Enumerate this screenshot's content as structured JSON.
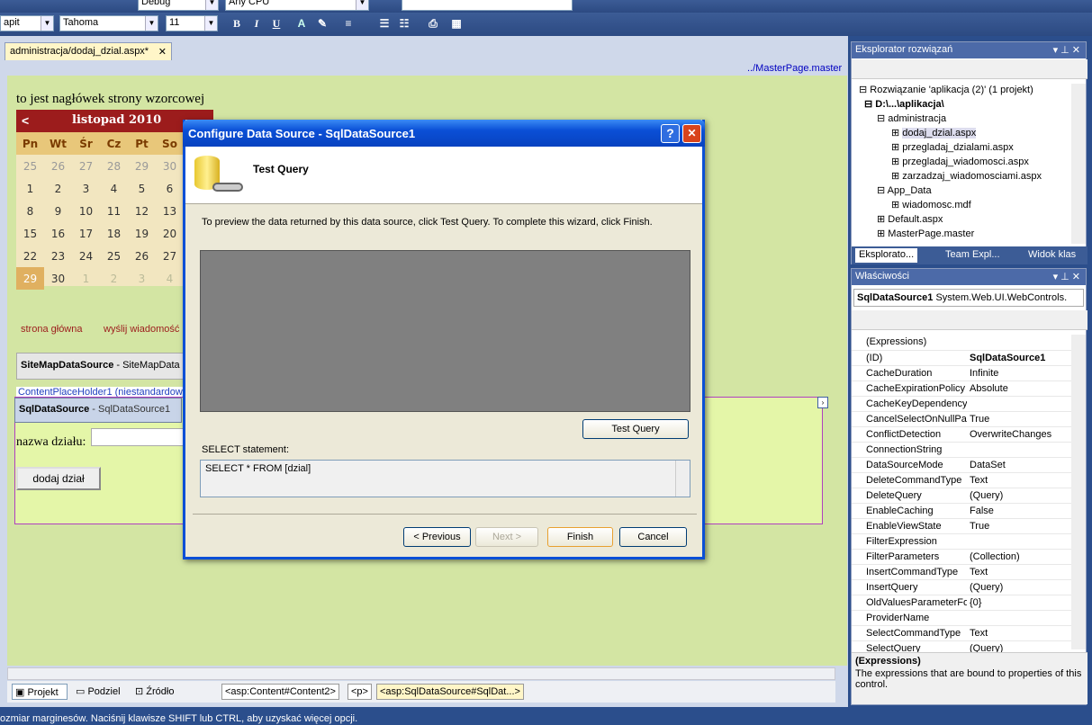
{
  "toolbar": {
    "config_combo": "Debug",
    "platform_combo": "Any CPU",
    "style_combo": "apit",
    "font_combo": "Tahoma",
    "size_combo": "11",
    "bold": "B",
    "italic": "I",
    "underline": "U",
    "font_color": "A"
  },
  "tab": {
    "label": "administracja/dodaj_dzial.aspx*",
    "close": "✕"
  },
  "master_link": "../MasterPage.master",
  "design": {
    "heading": "to jest nagłówek strony wzorcowej",
    "calendar": {
      "prev": "<",
      "title": "listopad 2010",
      "days": [
        "Pn",
        "Wt",
        "Śr",
        "Cz",
        "Pt",
        "So"
      ],
      "rows": [
        [
          "25",
          "26",
          "27",
          "28",
          "29",
          "30"
        ],
        [
          "1",
          "2",
          "3",
          "4",
          "5",
          "6"
        ],
        [
          "8",
          "9",
          "10",
          "11",
          "12",
          "13"
        ],
        [
          "15",
          "16",
          "17",
          "18",
          "19",
          "20"
        ],
        [
          "22",
          "23",
          "24",
          "25",
          "26",
          "27"
        ],
        [
          "29",
          "30",
          "1",
          "2",
          "3",
          "4"
        ]
      ]
    },
    "nav_home": "strona główna",
    "nav_send": "wyślij wiadomość",
    "sitemap_bold": "SiteMapDataSource",
    "sitemap_rest": " - SiteMapData",
    "placeholder": "ContentPlaceHolder1 (niestandardowy)",
    "sql_bold": "SqlDataSource",
    "sql_rest": " - SqlDataSource1",
    "field_label": "nazwa działu:",
    "add_button": "dodaj dział"
  },
  "bottom": {
    "design_tab": "Projekt",
    "split_tab": "Podziel",
    "source_tab": "Źródło",
    "crumbs": [
      "<asp:Content#Content2>",
      "<p>",
      "<asp:SqlDataSource#SqlDat...>"
    ]
  },
  "status": "ozmiar marginesów. Naciśnij klawisze SHIFT lub CTRL, aby uzyskać więcej opcji.",
  "solution": {
    "title": "Eksplorator rozwiązań",
    "items": [
      "Rozwiązanie 'aplikacja (2)' (1 projekt)",
      "D:\\...\\aplikacja\\",
      "administracja",
      "dodaj_dzial.aspx",
      "przegladaj_dzialami.aspx",
      "przegladaj_wiadomosci.aspx",
      "zarzadzaj_wiadomosciami.aspx",
      "App_Data",
      "wiadomosc.mdf",
      "Default.aspx",
      "MasterPage.master"
    ],
    "tabs": [
      "Eksplorato...",
      "Team Expl...",
      "Widok klas"
    ]
  },
  "properties": {
    "title": "Właściwości",
    "object_bold": "SqlDataSource1",
    "object_type": "System.Web.UI.WebControls.",
    "rows": [
      [
        "(Expressions)",
        ""
      ],
      [
        "(ID)",
        "SqlDataSource1"
      ],
      [
        "CacheDuration",
        "Infinite"
      ],
      [
        "CacheExpirationPolicy",
        "Absolute"
      ],
      [
        "CacheKeyDependency",
        ""
      ],
      [
        "CancelSelectOnNullPar",
        "True"
      ],
      [
        "ConflictDetection",
        "OverwriteChanges"
      ],
      [
        "ConnectionString",
        ""
      ],
      [
        "DataSourceMode",
        "DataSet"
      ],
      [
        "DeleteCommandType",
        "Text"
      ],
      [
        "DeleteQuery",
        "(Query)"
      ],
      [
        "EnableCaching",
        "False"
      ],
      [
        "EnableViewState",
        "True"
      ],
      [
        "FilterExpression",
        ""
      ],
      [
        "FilterParameters",
        "(Collection)"
      ],
      [
        "InsertCommandType",
        "Text"
      ],
      [
        "InsertQuery",
        "(Query)"
      ],
      [
        "OldValuesParameterFo",
        "{0}"
      ],
      [
        "ProviderName",
        ""
      ],
      [
        "SelectCommandType",
        "Text"
      ],
      [
        "SelectQuery",
        "(Query)"
      ]
    ],
    "desc_title": "(Expressions)",
    "desc_text": "The expressions that are bound to properties of this control."
  },
  "dialog": {
    "title": "Configure Data Source - SqlDataSource1",
    "help": "?",
    "close": "✕",
    "heading": "Test Query",
    "instructions": "To preview the data returned by this data source, click Test Query. To complete this wizard, click Finish.",
    "test_query": "Test Query",
    "select_label": "SELECT statement:",
    "select_value": "SELECT * FROM [dzial]",
    "previous": "< Previous",
    "next": "Next >",
    "finish": "Finish",
    "cancel": "Cancel"
  },
  "colors": {
    "calendar_header": "#9c1c1c",
    "design_bg": "#d3e5a3",
    "dialog_title": "#0a4fd6"
  }
}
